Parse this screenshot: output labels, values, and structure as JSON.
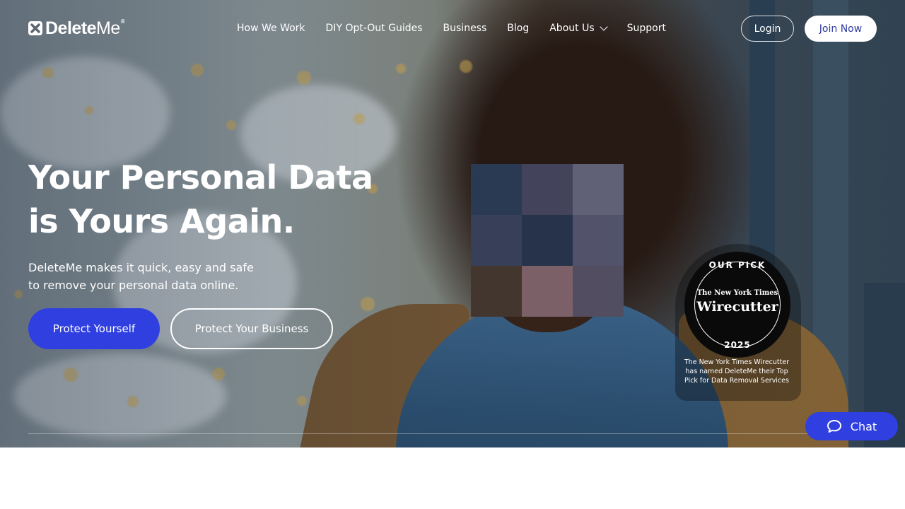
{
  "brand": {
    "name_bold": "Delete",
    "name_light": "Me",
    "registered": "®"
  },
  "nav": {
    "items": [
      {
        "label": "How We Work"
      },
      {
        "label": "DIY Opt-Out Guides"
      },
      {
        "label": "Business"
      },
      {
        "label": "Blog"
      },
      {
        "label": "About Us"
      },
      {
        "label": "Support"
      }
    ],
    "login_label": "Login",
    "join_label": "Join Now"
  },
  "hero": {
    "headline_line1": "Your Personal Data",
    "headline_line2": "is Yours Again.",
    "subtext_line1": "DeleteMe makes it quick, easy and safe",
    "subtext_line2": "to remove your personal data online.",
    "primary_cta": "Protect Yourself",
    "secondary_cta": "Protect Your Business"
  },
  "badge": {
    "top": "OUR PICK",
    "publisher": "The New York Times",
    "name": "Wirecutter",
    "year": "2025",
    "caption": "The New York Times Wirecutter has named DeleteMe their Top Pick for Data Removal Services"
  },
  "chat": {
    "label": "Chat",
    "icon": "chat-bubble-icon"
  },
  "colors": {
    "accent": "#2f3fe0",
    "join_text": "#2c3a9e"
  }
}
